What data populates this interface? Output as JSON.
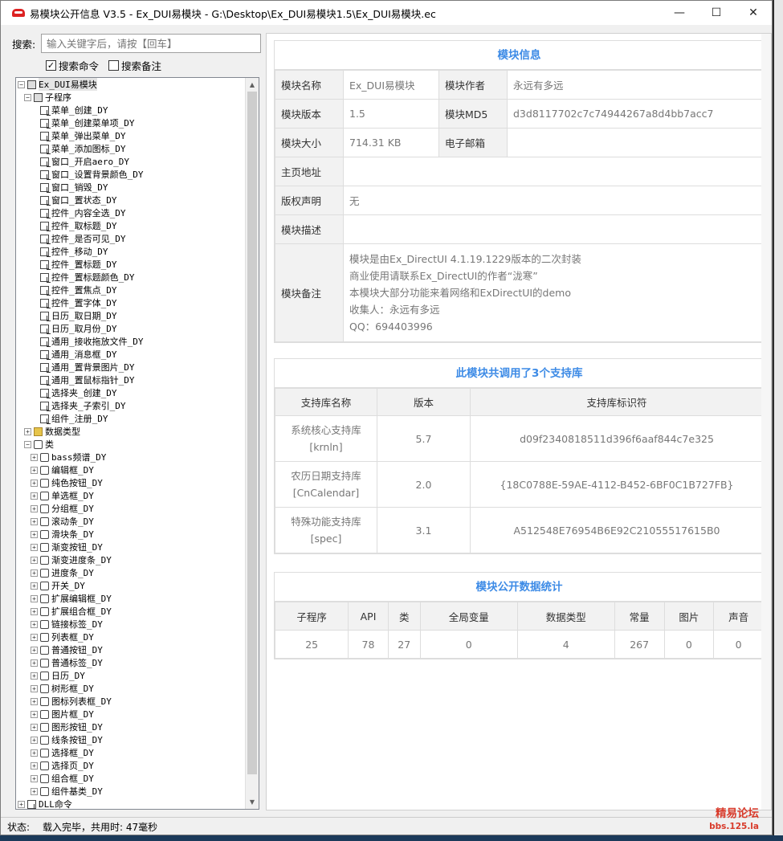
{
  "window": {
    "title": "易模块公开信息 V3.5 - Ex_DUI易模块 - G:\\Desktop\\Ex_DUI易模块1.5\\Ex_DUI易模块.ec",
    "minimize_icon": "minimize-icon",
    "maximize_icon": "maximize-icon",
    "close_icon": "close-icon"
  },
  "search": {
    "label": "搜索:",
    "placeholder": "输入关键字后，请按【回车】",
    "opt_command": "搜索命令",
    "opt_command_checked": true,
    "opt_note": "搜索备注",
    "opt_note_checked": false
  },
  "tree": {
    "root": "Ex_DUI易模块",
    "subprogram_group": "子程序",
    "subprograms": [
      "菜单_创建_DY",
      "菜单_创建菜单项_DY",
      "菜单_弹出菜单_DY",
      "菜单_添加图标_DY",
      "窗口_开启aero_DY",
      "窗口_设置背景颜色_DY",
      "窗口_销毁_DY",
      "窗口_置状态_DY",
      "控件_内容全选_DY",
      "控件_取标题_DY",
      "控件_是否可见_DY",
      "控件_移动_DY",
      "控件_置标题_DY",
      "控件_置标题颜色_DY",
      "控件_置焦点_DY",
      "控件_置字体_DY",
      "日历_取日期_DY",
      "日历_取月份_DY",
      "通用_接收拖放文件_DY",
      "通用_消息框_DY",
      "通用_置背景图片_DY",
      "通用_置鼠标指针_DY",
      "选择夹_创建_DY",
      "选择夹_子索引_DY",
      "组件_注册_DY"
    ],
    "datatype_group": "数据类型",
    "class_group": "类",
    "classes": [
      "bass频谱_DY",
      "编辑框_DY",
      "纯色按钮_DY",
      "单选框_DY",
      "分组框_DY",
      "滚动条_DY",
      "滑块条_DY",
      "渐变按钮_DY",
      "渐变进度条_DY",
      "进度条_DY",
      "开关_DY",
      "扩展编辑框_DY",
      "扩展组合框_DY",
      "链接标签_DY",
      "列表框_DY",
      "普通按钮_DY",
      "普通标签_DY",
      "日历_DY",
      "树形框_DY",
      "图标列表框_DY",
      "图片框_DY",
      "图形按钮_DY",
      "线条按钮_DY",
      "选择框_DY",
      "选择页_DY",
      "组合框_DY",
      "组件基类_DY"
    ],
    "dll_group": "DLL命令"
  },
  "module_info": {
    "title": "模块信息",
    "name_label": "模块名称",
    "name_value": "Ex_DUI易模块",
    "author_label": "模块作者",
    "author_value": "永远有多远",
    "version_label": "模块版本",
    "version_value": "1.5",
    "md5_label": "模块MD5",
    "md5_value": "d3d8117702c7c74944267a8d4bb7acc7",
    "size_label": "模块大小",
    "size_value": "714.31 KB",
    "email_label": "电子邮箱",
    "email_value": "",
    "homepage_label": "主页地址",
    "homepage_value": "",
    "copyright_label": "版权声明",
    "copyright_value": "无",
    "desc_label": "模块描述",
    "desc_value": "",
    "note_label": "模块备注",
    "note_lines": [
      "模块是由Ex_DirectUI 4.1.19.1229版本的二次封装",
      "商业使用请联系Ex_DirectUI的作者“泷寒”",
      "本模块大部分功能来着网络和ExDirectUI的demo",
      "收集人：永远有多远",
      "QQ：694403996"
    ]
  },
  "libs": {
    "title": "此模块共调用了3个支持库",
    "headers": [
      "支持库名称",
      "版本",
      "支持库标识符"
    ],
    "rows": [
      {
        "name": "系统核心支持库",
        "code": "[krnln]",
        "version": "5.7",
        "id": "d09f2340818511d396f6aaf844c7e325"
      },
      {
        "name": "农历日期支持库",
        "code": "[CnCalendar]",
        "version": "2.0",
        "id": "{18C0788E-59AE-4112-B452-6BF0C1B727FB}"
      },
      {
        "name": "特殊功能支持库",
        "code": "[spec]",
        "version": "3.1",
        "id": "A512548E76954B6E92C21055517615B0"
      }
    ]
  },
  "stats": {
    "title": "模块公开数据统计",
    "headers": [
      "子程序",
      "API",
      "类",
      "全局变量",
      "数据类型",
      "常量",
      "图片",
      "声音"
    ],
    "values": [
      "25",
      "78",
      "27",
      "0",
      "4",
      "267",
      "0",
      "0"
    ]
  },
  "status": {
    "label": "状态:",
    "text": "载入完毕，共用时: 47毫秒"
  },
  "watermark": {
    "line1": "精易论坛",
    "line2": "bbs.125.la"
  }
}
